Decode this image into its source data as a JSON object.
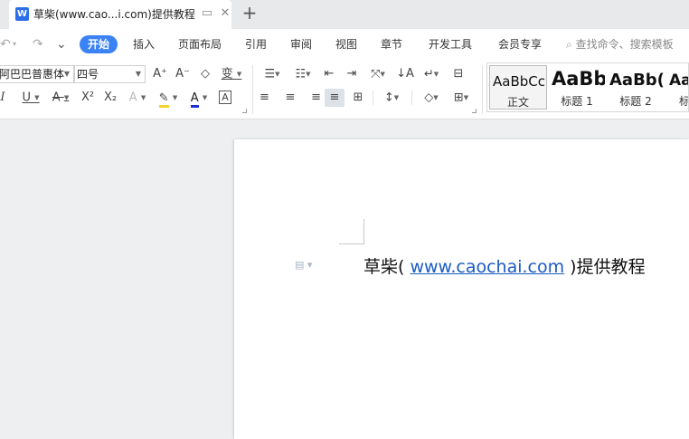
{
  "tab": {
    "app_icon_letter": "W",
    "title": "草柴(www.cao...i.com)提供教程",
    "icons": [
      "monitor-icon",
      "close-icon"
    ],
    "new_tab_label": "+"
  },
  "quick_access": {
    "undo": "↶",
    "redo": "↷",
    "more": "⌄"
  },
  "menu": {
    "items": [
      "开始",
      "插入",
      "页面布局",
      "引用",
      "审阅",
      "视图",
      "章节",
      "开发工具",
      "会员专享"
    ],
    "active_index": 0,
    "search_placeholder": "查找命令、搜索模板"
  },
  "ribbon": {
    "font_name": "阿巴巴普惠体",
    "font_size": "四号",
    "dropdown_arrow": "▼",
    "font_buttons_row1": [
      "A⁺",
      "A⁻",
      "◇",
      "变"
    ],
    "font_buttons_row2": [
      "I",
      "U",
      "A",
      "X²",
      "X₂",
      "A",
      "A",
      "A",
      "A"
    ],
    "para_buttons_row1": [
      "☰",
      "☷",
      "⇤",
      "⇥",
      "⤧",
      "↓A",
      "↵",
      "⊟"
    ],
    "para_buttons_row2": [
      "≡",
      "≡",
      "≡",
      "≡",
      "⊞",
      "↕",
      "◇",
      "⊞"
    ],
    "styles": [
      {
        "sample": "AaBbCcI",
        "name": "正文"
      },
      {
        "sample": "AaBb",
        "name": "标题 1"
      },
      {
        "sample": "AaBb(",
        "name": "标题 2"
      },
      {
        "sample": "AaI",
        "name": "标"
      }
    ]
  },
  "document": {
    "text_before": "草柴( ",
    "link_text": "www.caochai.com",
    "text_after": " )提供教程",
    "para_marker": "▤ ▾"
  },
  "colors": {
    "accent": "#3a82f6",
    "link": "#1a5bc4",
    "font_color_underline": "#1a2fd6",
    "highlight_underline": "#f2d22b"
  }
}
